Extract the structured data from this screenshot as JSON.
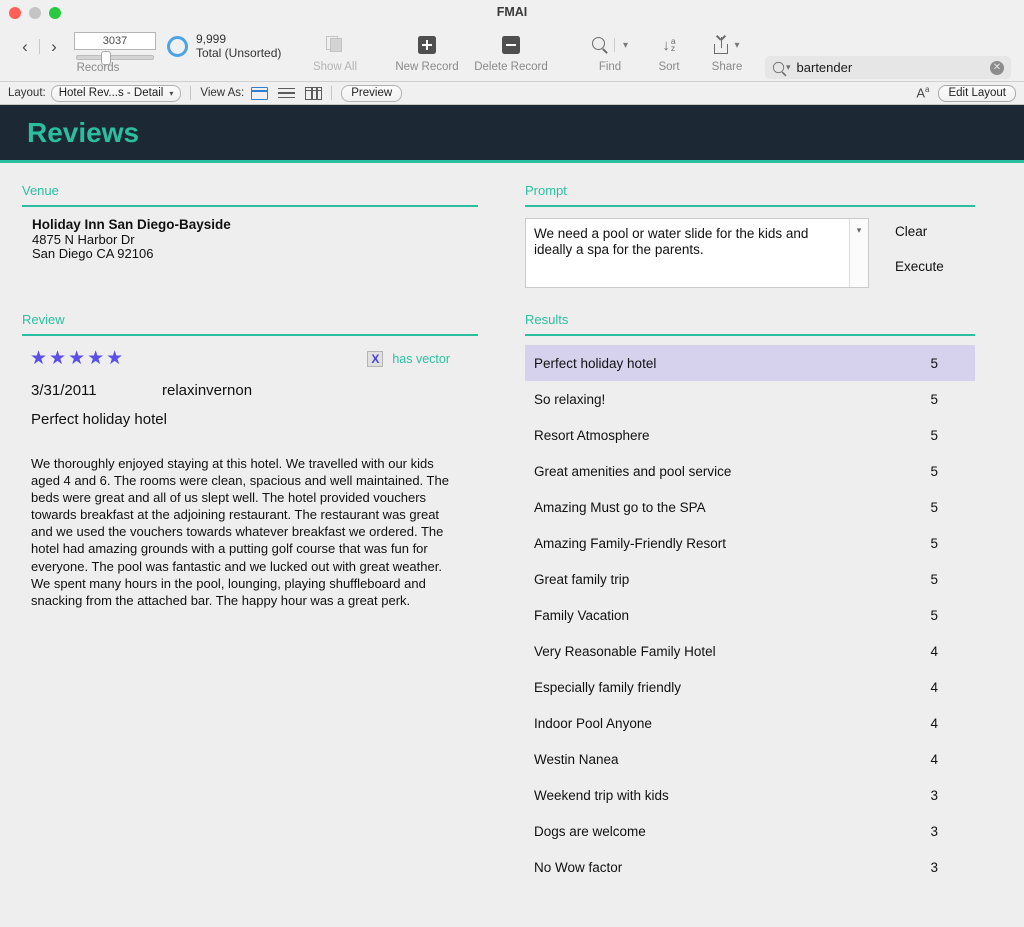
{
  "window": {
    "title": "FMAI"
  },
  "toolbar": {
    "nav": {
      "prev_icon": "chevron-left-icon",
      "next_icon": "chevron-right-icon",
      "record_number": "3037",
      "total_count": "9,999",
      "total_label": "Total (Unsorted)",
      "group_label": "Records"
    },
    "show_all_label": "Show All",
    "new_record_label": "New Record",
    "delete_record_label": "Delete Record",
    "find_label": "Find",
    "sort_label": "Sort",
    "share_label": "Share",
    "search": {
      "value": "bartender",
      "placeholder": "Search",
      "clear_glyph": "✕"
    }
  },
  "layoutbar": {
    "layout_label": "Layout:",
    "layout_value": "Hotel Rev...s - Detail",
    "view_as_label": "View As:",
    "preview_label": "Preview",
    "text_format_label": "Aa",
    "edit_layout_label": "Edit Layout"
  },
  "banner": {
    "title": "Reviews",
    "bg_color": "#1c2833",
    "accent_color": "#2bbfa0"
  },
  "venue": {
    "section_title": "Venue",
    "name": "Holiday Inn San Diego-Bayside",
    "street": "4875 N Harbor Dr",
    "city_state_zip": "San Diego CA 92106"
  },
  "review": {
    "section_title": "Review",
    "stars": "★★★★★",
    "star_count": 5,
    "star_color": "#5b4fe8",
    "has_vector_checkbox": "X",
    "has_vector_label": "has vector",
    "date": "3/31/2011",
    "author": "relaxinvernon",
    "title": "Perfect holiday hotel",
    "body": "We thoroughly enjoyed staying at this hotel. We travelled with our kids aged 4 and 6. The rooms were clean, spacious and well maintained. The beds were great and all of us slept well. The hotel provided vouchers towards breakfast at the adjoining restaurant. The restaurant was great and we used the vouchers towards whatever breakfast we ordered. The hotel had amazing grounds with a putting golf course that was fun for everyone. The pool was fantastic and we lucked out with great weather. We spent many hours in the pool, lounging, playing shuffleboard and snacking from the attached bar. The happy hour was a great perk."
  },
  "prompt": {
    "section_title": "Prompt",
    "value": "We need a pool or water slide for the kids and ideally a spa for the parents.",
    "clear_label": "Clear",
    "execute_label": "Execute"
  },
  "results": {
    "section_title": "Results",
    "selected_index": 0,
    "selection_color": "#d6d2ee",
    "rows": [
      {
        "name": "Perfect holiday hotel",
        "score": "5"
      },
      {
        "name": "So relaxing!",
        "score": "5"
      },
      {
        "name": "Resort Atmosphere",
        "score": "5"
      },
      {
        "name": "Great amenities and pool service",
        "score": "5"
      },
      {
        "name": "Amazing Must go to the SPA",
        "score": "5"
      },
      {
        "name": "Amazing Family-Friendly Resort",
        "score": "5"
      },
      {
        "name": "Great family trip",
        "score": "5"
      },
      {
        "name": "Family Vacation",
        "score": "5"
      },
      {
        "name": "Very Reasonable Family Hotel",
        "score": "4"
      },
      {
        "name": "Especially family friendly",
        "score": "4"
      },
      {
        "name": "Indoor Pool Anyone",
        "score": "4"
      },
      {
        "name": "Westin Nanea",
        "score": "4"
      },
      {
        "name": "Weekend trip with kids",
        "score": "3"
      },
      {
        "name": "Dogs are welcome",
        "score": "3"
      },
      {
        "name": "No Wow factor",
        "score": "3"
      }
    ]
  }
}
